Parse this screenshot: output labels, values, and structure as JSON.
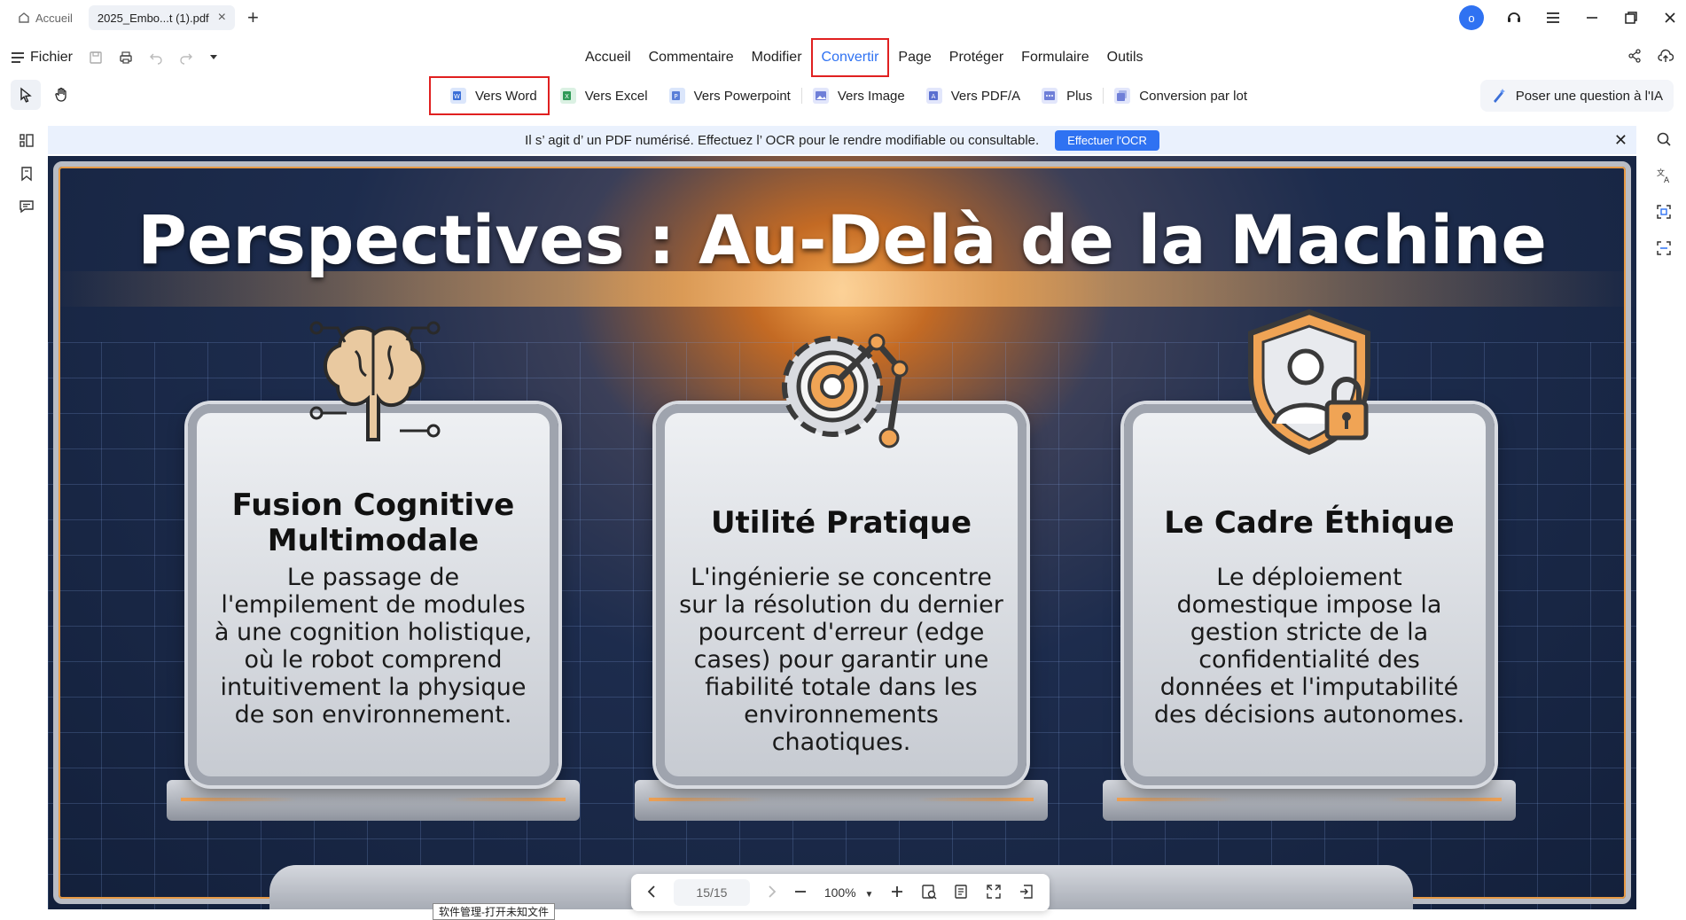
{
  "titlebar": {
    "home_tab": "Accueil",
    "file_tab": "2025_Embo...t (1).pdf",
    "avatar_letter": "o"
  },
  "menu": {
    "fichier": "Fichier",
    "items": [
      "Accueil",
      "Commentaire",
      "Modifier",
      "Convertir",
      "Page",
      "Protéger",
      "Formulaire",
      "Outils"
    ],
    "active": "Convertir"
  },
  "convert": {
    "items": [
      {
        "label": "Vers Word",
        "color": "#3b6fd8"
      },
      {
        "label": "Vers Excel",
        "color": "#2e9a56"
      },
      {
        "label": "Vers Powerpoint",
        "color": "#d9622b"
      },
      {
        "label": "Vers Image",
        "color": "#6f7fd8"
      },
      {
        "label": "Vers PDF/A",
        "color": "#5a6fd0"
      },
      {
        "label": "Plus",
        "color": "#6f7fd8"
      },
      {
        "label": "Conversion par lot",
        "color": "#6f7fd8"
      }
    ],
    "ask_ai": "Poser une question à l'IA"
  },
  "ocr_banner": {
    "message": "Il s’ agit d’ un PDF numérisé. Effectuez l’ OCR pour le rendre modifiable ou consultable.",
    "button": "Effectuer l'OCR"
  },
  "document": {
    "title": "Perspectives : Au-Delà de la Machine",
    "cards": [
      {
        "title": "Fusion Cognitive Multimodale",
        "body": "Le passage de l'empilement de modules à une cognition holistique, où le robot comprend intuitivement la physique de son environnement."
      },
      {
        "title": "Utilité Pratique",
        "body": "L'ingénierie se concentre sur la résolution du dernier pourcent d'erreur (edge cases) pour garantir une fiabilité totale dans les environnements chaotiques."
      },
      {
        "title": "Le Cadre Éthique",
        "body": "Le déploiement domestique impose la gestion stricte de la confidentialité des données et l'imputabilité des décisions autonomes."
      }
    ]
  },
  "pagebar": {
    "page": "15/15",
    "zoom": "100%"
  },
  "tooltip": "软件管理-打开未知文件",
  "colors": {
    "accent": "#2f72f2",
    "highlight": "#e02020"
  }
}
